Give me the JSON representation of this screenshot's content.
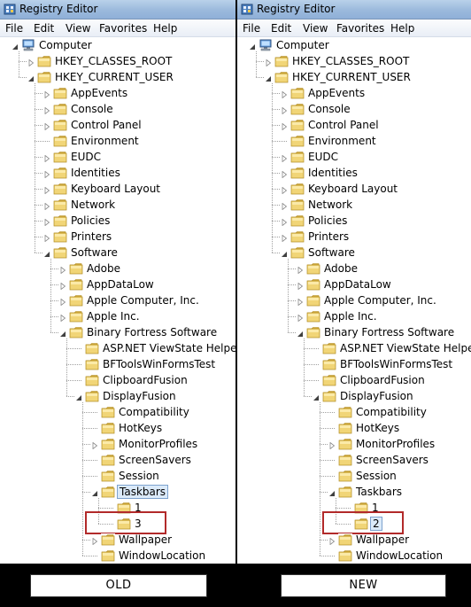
{
  "left": {
    "window_title": "Registry Editor",
    "menu": [
      "File",
      "Edit",
      "View",
      "Favorites",
      "Help"
    ],
    "tree": [
      {
        "label": "Computer",
        "icon": "computer-icon",
        "level": 0,
        "exp": "open"
      },
      {
        "label": "HKEY_CLASSES_ROOT",
        "icon": "folder-icon",
        "level": 1,
        "exp": "closed"
      },
      {
        "label": "HKEY_CURRENT_USER",
        "icon": "folder-icon",
        "level": 1,
        "exp": "open"
      },
      {
        "label": "AppEvents",
        "icon": "folder-icon",
        "level": 2,
        "exp": "closed"
      },
      {
        "label": "Console",
        "icon": "folder-icon",
        "level": 2,
        "exp": "closed"
      },
      {
        "label": "Control Panel",
        "icon": "folder-icon",
        "level": 2,
        "exp": "closed"
      },
      {
        "label": "Environment",
        "icon": "folder-icon",
        "level": 2,
        "exp": "none"
      },
      {
        "label": "EUDC",
        "icon": "folder-icon",
        "level": 2,
        "exp": "closed"
      },
      {
        "label": "Identities",
        "icon": "folder-icon",
        "level": 2,
        "exp": "closed"
      },
      {
        "label": "Keyboard Layout",
        "icon": "folder-icon",
        "level": 2,
        "exp": "closed"
      },
      {
        "label": "Network",
        "icon": "folder-icon",
        "level": 2,
        "exp": "closed"
      },
      {
        "label": "Policies",
        "icon": "folder-icon",
        "level": 2,
        "exp": "closed"
      },
      {
        "label": "Printers",
        "icon": "folder-icon",
        "level": 2,
        "exp": "closed"
      },
      {
        "label": "Software",
        "icon": "folder-icon",
        "level": 2,
        "exp": "open"
      },
      {
        "label": "Adobe",
        "icon": "folder-icon",
        "level": 3,
        "exp": "closed"
      },
      {
        "label": "AppDataLow",
        "icon": "folder-icon",
        "level": 3,
        "exp": "closed"
      },
      {
        "label": "Apple Computer, Inc.",
        "icon": "folder-icon",
        "level": 3,
        "exp": "closed"
      },
      {
        "label": "Apple Inc.",
        "icon": "folder-icon",
        "level": 3,
        "exp": "closed"
      },
      {
        "label": "Binary Fortress Software",
        "icon": "folder-icon",
        "level": 3,
        "exp": "open"
      },
      {
        "label": "ASP.NET ViewState Helper",
        "icon": "folder-icon",
        "level": 4,
        "exp": "none"
      },
      {
        "label": "BFToolsWinFormsTest",
        "icon": "folder-icon",
        "level": 4,
        "exp": "none"
      },
      {
        "label": "ClipboardFusion",
        "icon": "folder-icon",
        "level": 4,
        "exp": "none"
      },
      {
        "label": "DisplayFusion",
        "icon": "folder-icon",
        "level": 4,
        "exp": "open"
      },
      {
        "label": "Compatibility",
        "icon": "folder-icon",
        "level": 5,
        "exp": "none"
      },
      {
        "label": "HotKeys",
        "icon": "folder-icon",
        "level": 5,
        "exp": "none"
      },
      {
        "label": "MonitorProfiles",
        "icon": "folder-icon",
        "level": 5,
        "exp": "closed"
      },
      {
        "label": "ScreenSavers",
        "icon": "folder-icon",
        "level": 5,
        "exp": "none"
      },
      {
        "label": "Session",
        "icon": "folder-icon",
        "level": 5,
        "exp": "none"
      },
      {
        "label": "Taskbars",
        "icon": "folder-icon",
        "level": 5,
        "exp": "open",
        "selected": true
      },
      {
        "label": "1",
        "icon": "folder-icon",
        "level": 6,
        "exp": "none"
      },
      {
        "label": "3",
        "icon": "folder-icon",
        "level": 6,
        "exp": "none",
        "boxed": true
      },
      {
        "label": "Wallpaper",
        "icon": "folder-icon",
        "level": 5,
        "exp": "closed"
      },
      {
        "label": "WindowLocation",
        "icon": "folder-icon",
        "level": 5,
        "exp": "none"
      }
    ],
    "caption": "OLD"
  },
  "right": {
    "window_title": "Registry Editor",
    "menu": [
      "File",
      "Edit",
      "View",
      "Favorites",
      "Help"
    ],
    "tree": [
      {
        "label": "Computer",
        "icon": "computer-icon",
        "level": 0,
        "exp": "open"
      },
      {
        "label": "HKEY_CLASSES_ROOT",
        "icon": "folder-icon",
        "level": 1,
        "exp": "closed"
      },
      {
        "label": "HKEY_CURRENT_USER",
        "icon": "folder-icon",
        "level": 1,
        "exp": "open"
      },
      {
        "label": "AppEvents",
        "icon": "folder-icon",
        "level": 2,
        "exp": "closed"
      },
      {
        "label": "Console",
        "icon": "folder-icon",
        "level": 2,
        "exp": "closed"
      },
      {
        "label": "Control Panel",
        "icon": "folder-icon",
        "level": 2,
        "exp": "closed"
      },
      {
        "label": "Environment",
        "icon": "folder-icon",
        "level": 2,
        "exp": "none"
      },
      {
        "label": "EUDC",
        "icon": "folder-icon",
        "level": 2,
        "exp": "closed"
      },
      {
        "label": "Identities",
        "icon": "folder-icon",
        "level": 2,
        "exp": "closed"
      },
      {
        "label": "Keyboard Layout",
        "icon": "folder-icon",
        "level": 2,
        "exp": "closed"
      },
      {
        "label": "Network",
        "icon": "folder-icon",
        "level": 2,
        "exp": "closed"
      },
      {
        "label": "Policies",
        "icon": "folder-icon",
        "level": 2,
        "exp": "closed"
      },
      {
        "label": "Printers",
        "icon": "folder-icon",
        "level": 2,
        "exp": "closed"
      },
      {
        "label": "Software",
        "icon": "folder-icon",
        "level": 2,
        "exp": "open"
      },
      {
        "label": "Adobe",
        "icon": "folder-icon",
        "level": 3,
        "exp": "closed"
      },
      {
        "label": "AppDataLow",
        "icon": "folder-icon",
        "level": 3,
        "exp": "closed"
      },
      {
        "label": "Apple Computer, Inc.",
        "icon": "folder-icon",
        "level": 3,
        "exp": "closed"
      },
      {
        "label": "Apple Inc.",
        "icon": "folder-icon",
        "level": 3,
        "exp": "closed"
      },
      {
        "label": "Binary Fortress Software",
        "icon": "folder-icon",
        "level": 3,
        "exp": "open"
      },
      {
        "label": "ASP.NET ViewState Helper",
        "icon": "folder-icon",
        "level": 4,
        "exp": "none"
      },
      {
        "label": "BFToolsWinFormsTest",
        "icon": "folder-icon",
        "level": 4,
        "exp": "none"
      },
      {
        "label": "ClipboardFusion",
        "icon": "folder-icon",
        "level": 4,
        "exp": "none"
      },
      {
        "label": "DisplayFusion",
        "icon": "folder-icon",
        "level": 4,
        "exp": "open"
      },
      {
        "label": "Compatibility",
        "icon": "folder-icon",
        "level": 5,
        "exp": "none"
      },
      {
        "label": "HotKeys",
        "icon": "folder-icon",
        "level": 5,
        "exp": "none"
      },
      {
        "label": "MonitorProfiles",
        "icon": "folder-icon",
        "level": 5,
        "exp": "closed"
      },
      {
        "label": "ScreenSavers",
        "icon": "folder-icon",
        "level": 5,
        "exp": "none"
      },
      {
        "label": "Session",
        "icon": "folder-icon",
        "level": 5,
        "exp": "none"
      },
      {
        "label": "Taskbars",
        "icon": "folder-icon",
        "level": 5,
        "exp": "open"
      },
      {
        "label": "1",
        "icon": "folder-icon",
        "level": 6,
        "exp": "none"
      },
      {
        "label": "2",
        "icon": "folder-icon",
        "level": 6,
        "exp": "none",
        "boxed": true,
        "selected": true
      },
      {
        "label": "Wallpaper",
        "icon": "folder-icon",
        "level": 5,
        "exp": "closed"
      },
      {
        "label": "WindowLocation",
        "icon": "folder-icon",
        "level": 5,
        "exp": "none"
      }
    ],
    "caption": "NEW"
  },
  "colors": {
    "highlight_box": "#b22a2a",
    "selection": "#dbeaf9",
    "folder": "#e8c65a"
  }
}
